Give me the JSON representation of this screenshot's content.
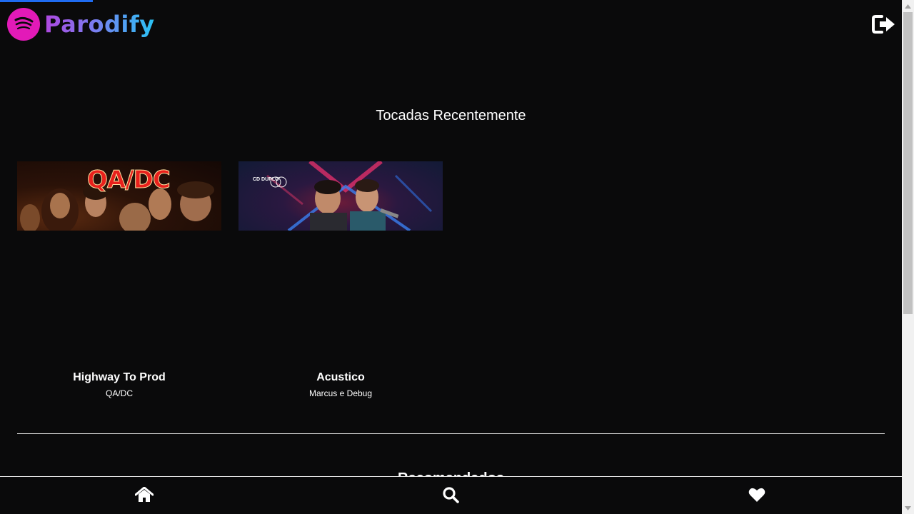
{
  "app": {
    "name": "Parodify",
    "accent_pink": "#e21ab8",
    "loading_color": "#1f6cf2"
  },
  "header": {
    "logo_icon": "spotify-waves-icon",
    "logout_icon": "sign-out-icon"
  },
  "recent": {
    "title": "Tocadas Recentemente",
    "items": [
      {
        "name": "Highway To Prod",
        "artist": "QA/DC",
        "cover_text": "QA/DC"
      },
      {
        "name": "Acustico",
        "artist": "Marcus e Debug",
        "cover_text": "CD DUPLO"
      }
    ]
  },
  "recommended": {
    "title": "Recomendados"
  },
  "nav": {
    "items": [
      {
        "icon": "home-icon"
      },
      {
        "icon": "search-icon"
      },
      {
        "icon": "heart-icon"
      }
    ]
  }
}
